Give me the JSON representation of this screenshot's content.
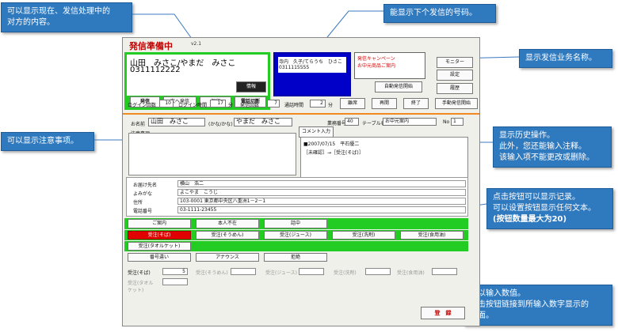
{
  "callouts": {
    "topleft": [
      "可以显示现在、发信处理中的",
      "对方的内容。"
    ],
    "topmid": [
      "能显示下个发信的号码。"
    ],
    "biz": [
      "显示发信业务名称。"
    ],
    "notes": [
      "可以显示注意事项。"
    ],
    "history": [
      "显示历史操作。",
      "此外，您还能输入注释。",
      "该输入项不能更改或删除。"
    ],
    "buttons": [
      "点击按钮可以显示记录。",
      "可以设置按钮显示任何文本。",
      "(按钮数量最大为20)"
    ],
    "numbers": [
      "可以输入数值。",
      "点击按钮链接到所输入数字显示的",
      "界面。"
    ]
  },
  "window": {
    "title": "発信準備中",
    "version": "v2.1",
    "customer": {
      "name": "山田　みさこ/やまだ　みさこ",
      "phone": "0311112222",
      "info_button": "情報"
    },
    "call_buttons": [
      "発信",
      "次へ発信",
      "保留",
      "電話切断"
    ],
    "next": {
      "line1": "寺内　久子/てらうち　ひさこ",
      "line2": "0311115555"
    },
    "business": {
      "label": "発信キャンペーン",
      "name": "お中元商品ご案内"
    },
    "side_buttons": [
      "モニター",
      "設定",
      "履歴"
    ],
    "auto_button": "自動発信開始",
    "manual_button": "手動発信開始",
    "stats": {
      "login_count_label": "ログイン回数",
      "login_count": "10",
      "login_time_label": "ログイン時間",
      "login_time": "17",
      "min1": "分",
      "call_count_label": "発信回数",
      "call_count": "7",
      "talk_time_label": "通話時間",
      "talk_time": "2",
      "min2": "分"
    },
    "ctrl_buttons": [
      "離席",
      "再開",
      "終了"
    ],
    "form": {
      "name_label": "お名前",
      "name_value": "山田　みさこ",
      "kana_label": "(かな/かな)",
      "kana_value": "やまだ　みさこ",
      "biz_no_label": "業務番号",
      "biz_no": "40",
      "table_label": "テーブル名",
      "table_value": "お中元案内",
      "no_label": "No",
      "no_value": "1",
      "comment_button": "コメント入力",
      "notes_label": "注意事項"
    },
    "history": [
      "■2007/07/15　平石優二",
      "［未確認］→［受注(そば)］"
    ],
    "info": {
      "rows": [
        {
          "label": "お届け先名",
          "value": "横山　浩二"
        },
        {
          "label": "よみがな",
          "value": "よこやま　こうじ"
        },
        {
          "label": "住所",
          "value": "103-0001 東京都中央区八重洲1－2－1"
        },
        {
          "label": "電話番号",
          "value": "03-1111-23455"
        }
      ]
    },
    "grid_row1": [
      "ご案内",
      "本人不在",
      "話中"
    ],
    "grid_row2": [
      "受注(そば)",
      "受注(そうめん)",
      "受注(ジュース)",
      "受注(洗剤)",
      "受注(食用油)"
    ],
    "grid_row3": [
      "受注(タオルケット)"
    ],
    "grid_row4": [
      "番号違い",
      "アナウンス",
      "拒絶"
    ],
    "qty": {
      "labels": [
        "受注(そば)",
        "受注(そうめん)",
        "受注(ジュース)",
        "受注(洗剤)",
        "受注(食用油)"
      ],
      "first_value": "5",
      "row2_label": "受注(タオルケット)"
    },
    "register_button": "登　録"
  }
}
